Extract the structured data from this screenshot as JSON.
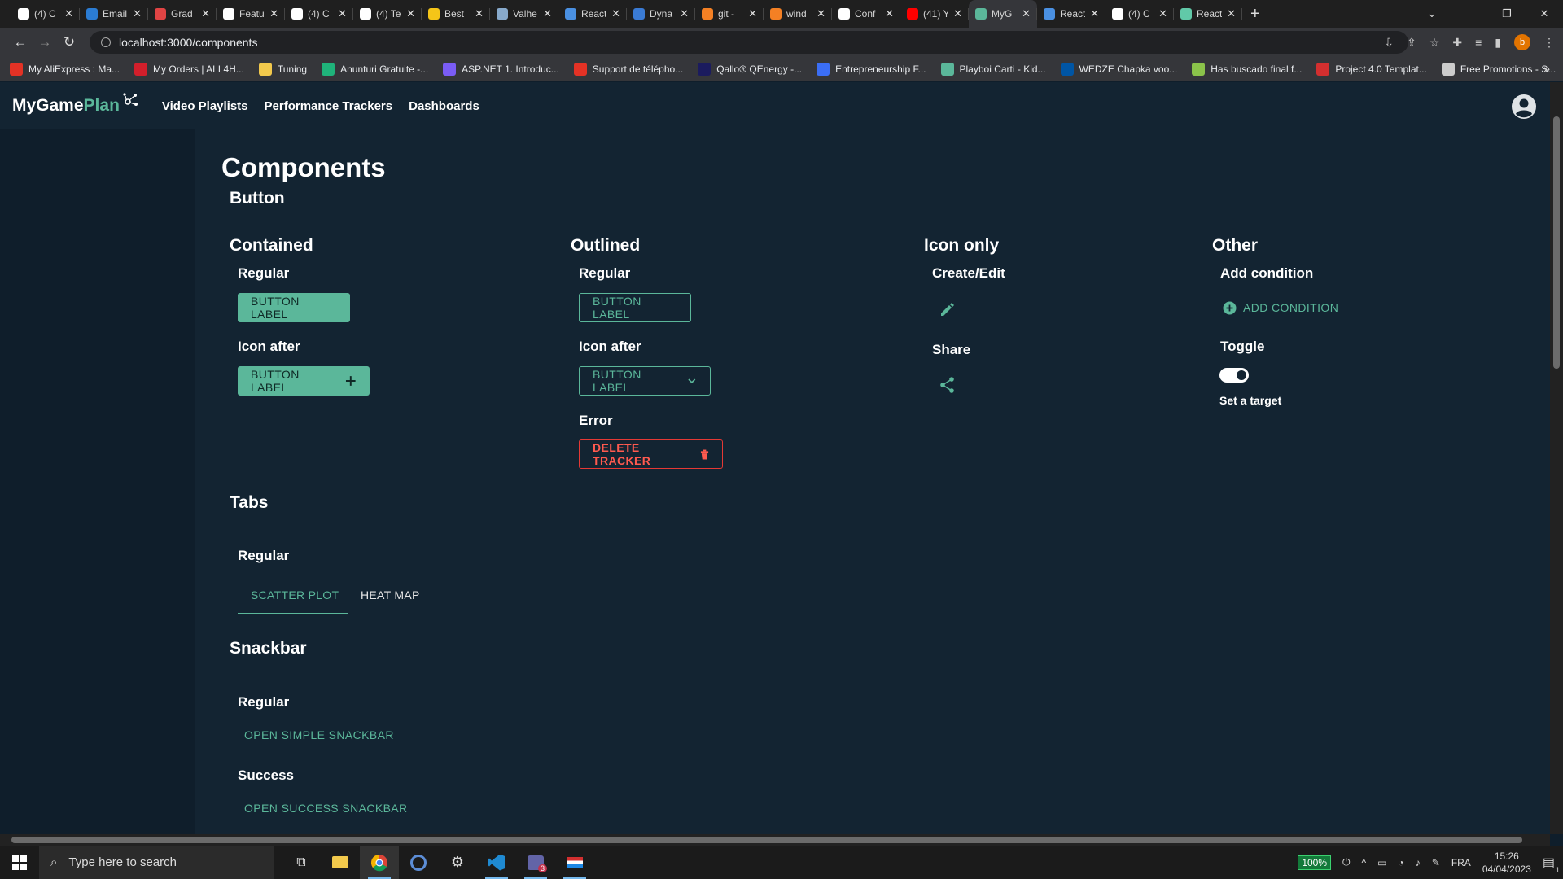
{
  "browser": {
    "tabs": [
      {
        "title": "(4) C",
        "color": "#ffffff"
      },
      {
        "title": "Email",
        "color": "#2b7cd3"
      },
      {
        "title": "Grad",
        "color": "#e04444"
      },
      {
        "title": "Featu",
        "color": "#ffffff"
      },
      {
        "title": "(4) C",
        "color": "#ffffff"
      },
      {
        "title": "(4) Te",
        "color": "#ffffff"
      },
      {
        "title": "Best",
        "color": "#f5c518"
      },
      {
        "title": "Valhe",
        "color": "#88aacc"
      },
      {
        "title": "React",
        "color": "#4a90e2"
      },
      {
        "title": "Dyna",
        "color": "#3a7bd5"
      },
      {
        "title": "git -",
        "color": "#f48024"
      },
      {
        "title": "wind",
        "color": "#f48024"
      },
      {
        "title": "Conf",
        "color": "#ffffff"
      },
      {
        "title": "(41) Y",
        "color": "#ff0000"
      },
      {
        "title": "MyG",
        "color": "#5bb79a",
        "active": true
      },
      {
        "title": "React",
        "color": "#4a90e2"
      },
      {
        "title": "(4) C",
        "color": "#ffffff"
      },
      {
        "title": "React",
        "color": "#61c9a8"
      }
    ],
    "url": "localhost:3000/components",
    "profile_initial": "b",
    "bookmarks": [
      {
        "label": "My AliExpress : Ma...",
        "color": "#e43225"
      },
      {
        "label": "My Orders | ALL4H...",
        "color": "#d31f2b"
      },
      {
        "label": "Tuning",
        "color": "#f2c94c"
      },
      {
        "label": "Anunturi Gratuite -...",
        "color": "#1fb37a"
      },
      {
        "label": "ASP.NET 1. Introduc...",
        "color": "#7a5cf5"
      },
      {
        "label": "Support de télépho...",
        "color": "#e43225"
      },
      {
        "label": "Qallo® QEnergy -...",
        "color": "#1b1b5e"
      },
      {
        "label": "Entrepreneurship F...",
        "color": "#3b6ef5"
      },
      {
        "label": "Playboi Carti - Kid...",
        "color": "#5bb79a"
      },
      {
        "label": "WEDZE Chapka voo...",
        "color": "#0055a4"
      },
      {
        "label": "Has buscado final f...",
        "color": "#8bc34a"
      },
      {
        "label": "Project 4.0 Templat...",
        "color": "#d32f2f"
      },
      {
        "label": "Free Promotions - S...",
        "color": "#cccccc"
      }
    ],
    "bookmarks_more": "»"
  },
  "app": {
    "logo_main": "MyGame",
    "logo_accent": "Plan",
    "nav": [
      "Video Playlists",
      "Performance Trackers",
      "Dashboards"
    ],
    "accent_color": "#5bb79a"
  },
  "page": {
    "title": "Components",
    "button_section": "Button",
    "contained": {
      "heading": "Contained",
      "regular_label": "Regular",
      "regular_button": "BUTTON LABEL",
      "icon_after_label": "Icon after",
      "icon_after_button": "BUTTON LABEL"
    },
    "outlined": {
      "heading": "Outlined",
      "regular_label": "Regular",
      "regular_button": "BUTTON LABEL",
      "icon_after_label": "Icon after",
      "icon_after_button": "BUTTON LABEL",
      "error_label": "Error",
      "error_button": "DELETE TRACKER"
    },
    "icon_only": {
      "heading": "Icon only",
      "create_label": "Create/Edit",
      "share_label": "Share"
    },
    "other": {
      "heading": "Other",
      "add_condition_label": "Add condition",
      "add_condition_button": "ADD CONDITION",
      "toggle_label": "Toggle",
      "toggle_on": true,
      "toggle_caption": "Set a target"
    },
    "tabs": {
      "heading": "Tabs",
      "regular_label": "Regular",
      "items": [
        "SCATTER PLOT",
        "HEAT MAP"
      ],
      "selected": 0
    },
    "snackbar": {
      "heading": "Snackbar",
      "regular_label": "Regular",
      "regular_button": "OPEN SIMPLE SNACKBAR",
      "success_label": "Success",
      "success_button": "OPEN SUCCESS SNACKBAR"
    }
  },
  "taskbar": {
    "search_placeholder": "Type here to search",
    "battery": "100%",
    "language": "FRA",
    "time": "15:26",
    "date": "04/04/2023",
    "notification_count": "1",
    "teams_badge": "3"
  }
}
